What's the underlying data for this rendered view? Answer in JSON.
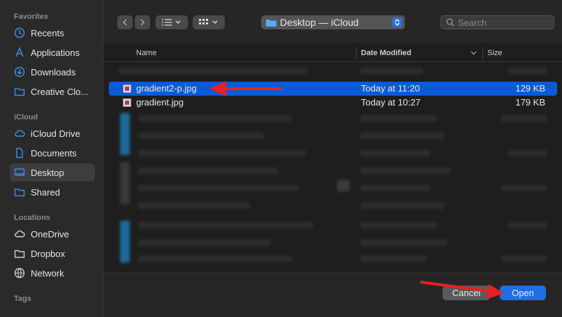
{
  "sidebar": {
    "sections": {
      "favorites": "Favorites",
      "icloud": "iCloud",
      "locations": "Locations",
      "tags": "Tags"
    },
    "items": {
      "recents": "Recents",
      "applications": "Applications",
      "downloads": "Downloads",
      "creative_cloud": "Creative Clo...",
      "icloud_drive": "iCloud Drive",
      "documents": "Documents",
      "desktop": "Desktop",
      "shared": "Shared",
      "onedrive": "OneDrive",
      "dropbox": "Dropbox",
      "network": "Network"
    },
    "active": "Desktop",
    "accent": "#3a8ee6"
  },
  "toolbar": {
    "location": "Desktop — iCloud",
    "search_placeholder": "Search"
  },
  "columns": {
    "name": "Name",
    "date": "Date Modified",
    "size": "Size"
  },
  "files": [
    {
      "name": "gradient2-p.jpg",
      "date": "Today at 11:20",
      "size": "129 KB",
      "selected": true
    },
    {
      "name": "gradient.jpg",
      "date": "Today at 10:27",
      "size": "179 KB",
      "selected": false
    }
  ],
  "buttons": {
    "cancel": "Cancel",
    "open": "Open"
  },
  "colors": {
    "selection": "#0a5bd6",
    "open_button": "#1e6fe4",
    "annotation_arrow": "#e8201f"
  }
}
